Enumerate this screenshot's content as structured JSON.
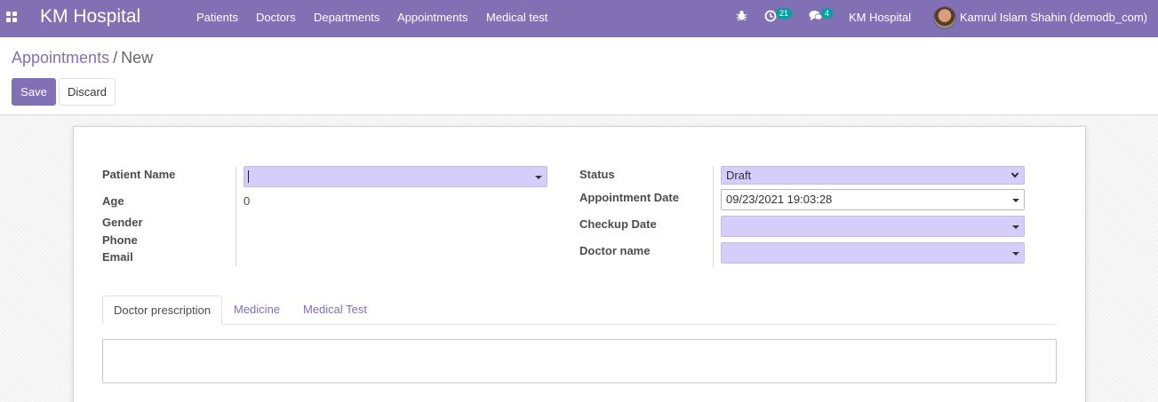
{
  "navbar": {
    "app_name": "KM Hospital",
    "menu": [
      "Patients",
      "Doctors",
      "Departments",
      "Appointments",
      "Medical test"
    ],
    "activity_count": "21",
    "message_count": "4",
    "company": "KM Hospital",
    "user": "Kamrul Islam Shahin (demodb_com)"
  },
  "breadcrumb": {
    "parent": "Appointments",
    "separator": "/",
    "current": "New"
  },
  "buttons": {
    "save": "Save",
    "discard": "Discard"
  },
  "form": {
    "left": {
      "patient_name_label": "Patient Name",
      "patient_name_value": "",
      "age_label": "Age",
      "age_value": "0",
      "gender_label": "Gender",
      "phone_label": "Phone",
      "email_label": "Email"
    },
    "right": {
      "status_label": "Status",
      "status_value": "Draft",
      "appointment_date_label": "Appointment Date",
      "appointment_date_value": "09/23/2021 19:03:28",
      "checkup_date_label": "Checkup Date",
      "checkup_date_value": "",
      "doctor_name_label": "Doctor name",
      "doctor_name_value": ""
    }
  },
  "tabs": [
    "Doctor prescription",
    "Medicine",
    "Medical Test"
  ],
  "colors": {
    "brand": "#8270b5",
    "required_field": "#d5cdfa",
    "badge": "#00a09d"
  }
}
